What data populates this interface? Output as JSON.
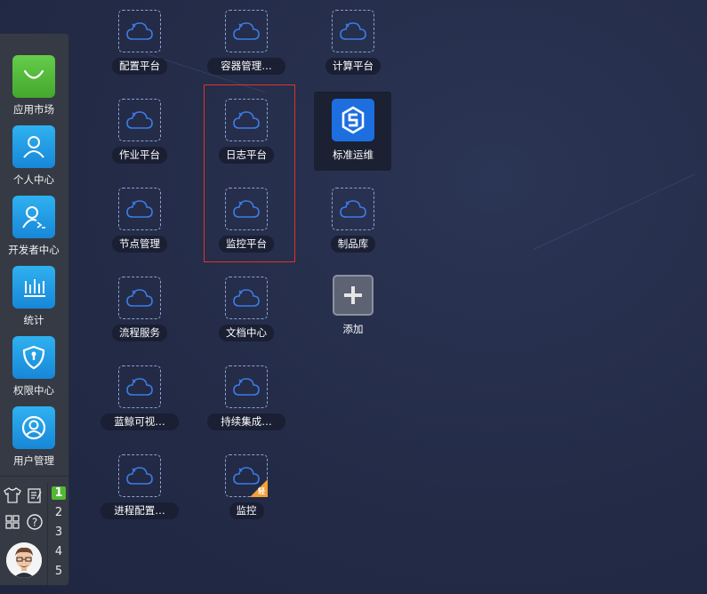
{
  "dock": {
    "apps": [
      {
        "label": "应用市场",
        "icon": "shopping-bag-icon",
        "color": "green"
      },
      {
        "label": "个人中心",
        "icon": "user-icon",
        "color": "blue"
      },
      {
        "label": "开发者中心",
        "icon": "developer-icon",
        "color": "blue"
      },
      {
        "label": "统计",
        "icon": "bar-chart-icon",
        "color": "blue"
      },
      {
        "label": "权限中心",
        "icon": "shield-icon",
        "color": "blue"
      },
      {
        "label": "用户管理",
        "icon": "user-circle-icon",
        "color": "blue"
      }
    ],
    "desktops": [
      "1",
      "2",
      "3",
      "4",
      "5"
    ],
    "active_desktop": "1",
    "help_glyph": "?"
  },
  "desktop": {
    "col1": [
      "配置平台",
      "作业平台",
      "节点管理",
      "流程服务",
      "蓝鲸可视…",
      "进程配置…"
    ],
    "col2": [
      "容器管理…",
      "日志平台",
      "监控平台",
      "文档中心",
      "持续集成…",
      "监控"
    ],
    "col3": [
      "计算平台",
      "标准运维",
      "制品库",
      "添加"
    ],
    "light_badge": "轻"
  },
  "colors": {
    "accent_blue": "#1d6fe0",
    "highlight_red": "#e0322f",
    "active_desktop_green": "#52b833"
  }
}
